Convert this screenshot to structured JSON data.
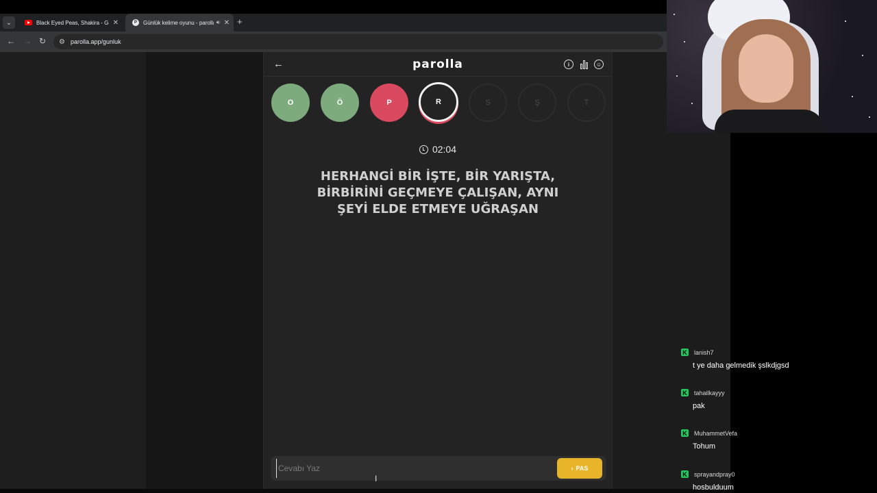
{
  "browser": {
    "tabs": [
      {
        "title": "Black Eyed Peas, Shakira - Girl Like Me",
        "favicon": "youtube-icon",
        "active": false
      },
      {
        "title": "Günlük kelime oyunu - parolla",
        "favicon": "parolla-icon",
        "active": true,
        "audio": true
      }
    ],
    "url": "parolla.app/gunluk"
  },
  "app": {
    "brand": "parolla",
    "letters": [
      {
        "char": "O",
        "state": "correct"
      },
      {
        "char": "Ö",
        "state": "correct"
      },
      {
        "char": "P",
        "state": "wrong"
      },
      {
        "char": "R",
        "state": "current"
      },
      {
        "char": "S",
        "state": "pending"
      },
      {
        "char": "Ş",
        "state": "pending"
      },
      {
        "char": "T",
        "state": "pending"
      }
    ],
    "timer": "02:04",
    "question": "HERHANGİ BİR İŞTE, BİR YARIŞTA, BİRBİRİNİ GEÇMEYE ÇALIŞAN, AYNI ŞEYİ ELDE ETMEYE UĞRAŞAN",
    "answer_placeholder": "Cevabı Yaz",
    "pass_label": "PAS"
  },
  "chat": [
    {
      "user": "lanish7",
      "text": "t ye daha gelmedik şslkdjgsd"
    },
    {
      "user": "tahailkayyy",
      "text": "pak"
    },
    {
      "user": "MuhammetVefa",
      "text": "Tohum"
    },
    {
      "user": "sprayandpray0",
      "text": "hosbulduum"
    }
  ],
  "colors": {
    "correct": "#7dab7e",
    "wrong": "#d9495f",
    "pass": "#e7b42a",
    "chat_badge": "#22c55e"
  }
}
